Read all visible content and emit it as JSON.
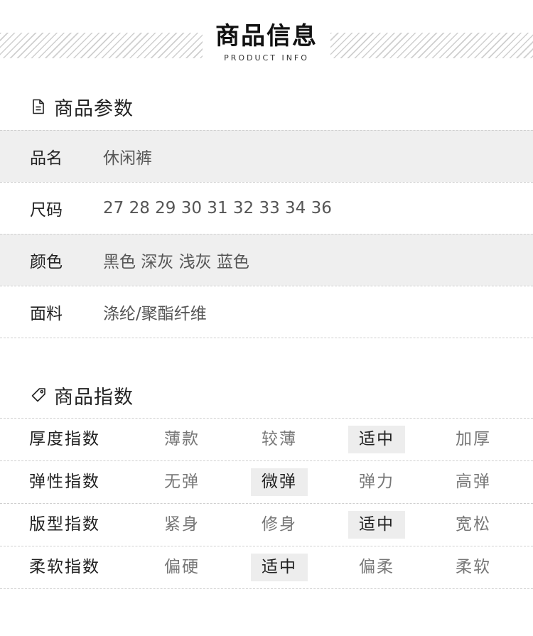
{
  "header": {
    "title": "商品信息",
    "subtitle": "PRODUCT INFO"
  },
  "params_section": {
    "title": "商品参数",
    "icon": "document-icon",
    "rows": [
      {
        "label": "品名",
        "value": "休闲裤"
      },
      {
        "label": "尺码",
        "value": "27 28 29 30 31 32 33 34 36"
      },
      {
        "label": "颜色",
        "value": "黑色 深灰 浅灰 蓝色"
      },
      {
        "label": "面料",
        "value": "涤纶/聚酯纤维"
      }
    ]
  },
  "index_section": {
    "title": "商品指数",
    "icon": "tag-icon",
    "rows": [
      {
        "label": "厚度指数",
        "options": [
          "薄款",
          "较薄",
          "适中",
          "加厚"
        ],
        "selected": 2
      },
      {
        "label": "弹性指数",
        "options": [
          "无弹",
          "微弹",
          "弹力",
          "高弹"
        ],
        "selected": 1
      },
      {
        "label": "版型指数",
        "options": [
          "紧身",
          "修身",
          "适中",
          "宽松"
        ],
        "selected": 2
      },
      {
        "label": "柔软指数",
        "options": [
          "偏硬",
          "适中",
          "偏柔",
          "柔软"
        ],
        "selected": 1
      }
    ]
  }
}
